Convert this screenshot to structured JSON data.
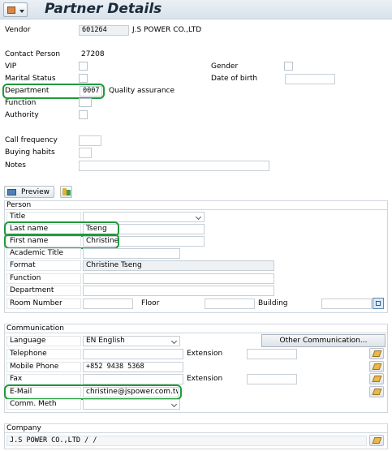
{
  "title": "Partner Details",
  "vendor": {
    "label": "Vendor",
    "number": "601264",
    "name": "J.S POWER CO.,LTD"
  },
  "contact": {
    "contact_person_label": "Contact Person",
    "contact_person_value": "27208",
    "vip_label": "VIP",
    "gender_label": "Gender",
    "marital_label": "Marital Status",
    "dob_label": "Date of birth",
    "department_label": "Department",
    "department_code": "0007",
    "department_text": "Quality assurance",
    "function_label": "Function",
    "authority_label": "Authority",
    "call_frequency_label": "Call frequency",
    "buying_habits_label": "Buying habits",
    "notes_label": "Notes"
  },
  "toolbar": {
    "preview_label": "Preview"
  },
  "person": {
    "group_title": "Person",
    "title_label": "Title",
    "last_name_label": "Last name",
    "last_name_value": "Tseng",
    "first_name_label": "First name",
    "first_name_value": "Christine",
    "academic_title_label": "Academic Title",
    "format_label": "Format",
    "format_value": "Christine Tseng",
    "function_label": "Function",
    "department_label": "Department",
    "room_label": "Room Number",
    "floor_label": "Floor",
    "building_label": "Building"
  },
  "communication": {
    "group_title": "Communication",
    "language_label": "Language",
    "language_value": "EN English",
    "other_button": "Other Communication...",
    "telephone_label": "Telephone",
    "extension_label": "Extension",
    "mobile_label": "Mobile Phone",
    "mobile_value": "+852 9438 5368",
    "fax_label": "Fax",
    "fax_extension_label": "Extension",
    "email_label": "E-Mail",
    "email_value": "christine@jspower.com.tw",
    "comm_method_label": "Comm. Meth"
  },
  "company": {
    "group_title": "Company",
    "value": "J.S POWER CO.,LTD / /"
  },
  "colors": {
    "highlight": "#1f9a3a",
    "title_bar": "#dde6ee",
    "accent": "#0a5fa8"
  }
}
